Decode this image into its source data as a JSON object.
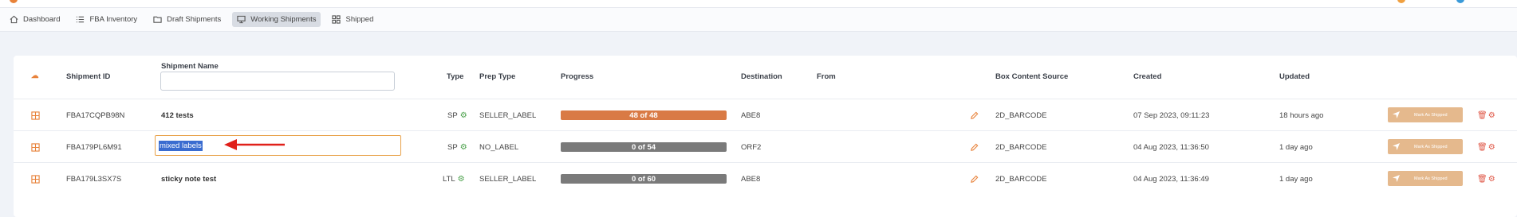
{
  "nav": {
    "items": [
      {
        "label": "Dashboard",
        "icon": "home-icon",
        "active": false
      },
      {
        "label": "FBA Inventory",
        "icon": "list-icon",
        "active": false
      },
      {
        "label": "Draft Shipments",
        "icon": "folder-icon",
        "active": false
      },
      {
        "label": "Working Shipments",
        "icon": "monitor-icon",
        "active": true
      },
      {
        "label": "Shipped",
        "icon": "grid-icon",
        "active": false
      }
    ]
  },
  "table": {
    "headers": {
      "shipment_id": "Shipment ID",
      "shipment_name": "Shipment Name",
      "type": "Type",
      "prep_type": "Prep Type",
      "progress": "Progress",
      "destination": "Destination",
      "from": "From",
      "box_content_source": "Box Content Source",
      "created": "Created",
      "updated": "Updated"
    },
    "rows": [
      {
        "id": "FBA17CQPB98N",
        "name": "412 tests",
        "type": "SP",
        "prep": "SELLER_LABEL",
        "progress": "48 of 48",
        "progress_fraction": 1.0,
        "progress_color": "#d97a45",
        "destination": "ABE8",
        "from": "",
        "box": "2D_BARCODE",
        "created": "07 Sep 2023, 09:11:23",
        "updated": "18 hours ago",
        "ship_label": "Mark As Shipped"
      },
      {
        "id": "FBA179PL6M91",
        "name": "mixed labels",
        "type": "SP",
        "prep": "NO_LABEL",
        "progress": "0 of 54",
        "progress_fraction": 0.0,
        "progress_color": "#7a7a7a",
        "destination": "ORF2",
        "from": "",
        "box": "2D_BARCODE",
        "created": "04 Aug 2023, 11:36:50",
        "updated": "1 day ago",
        "ship_label": "Mark As Shipped"
      },
      {
        "id": "FBA179L3SX7S",
        "name": "sticky note test",
        "type": "LTL",
        "prep": "SELLER_LABEL",
        "progress": "0 of 60",
        "progress_fraction": 0.0,
        "progress_color": "#7a7a7a",
        "destination": "ABE8",
        "from": "",
        "box": "2D_BARCODE",
        "created": "04 Aug 2023, 11:36:49",
        "updated": "1 day ago",
        "ship_label": "Mark As Shipped"
      }
    ]
  },
  "colors": {
    "accent": "#e8823a",
    "ship_button": "#e5b98d",
    "annotation_arrow": "#e0201a"
  }
}
